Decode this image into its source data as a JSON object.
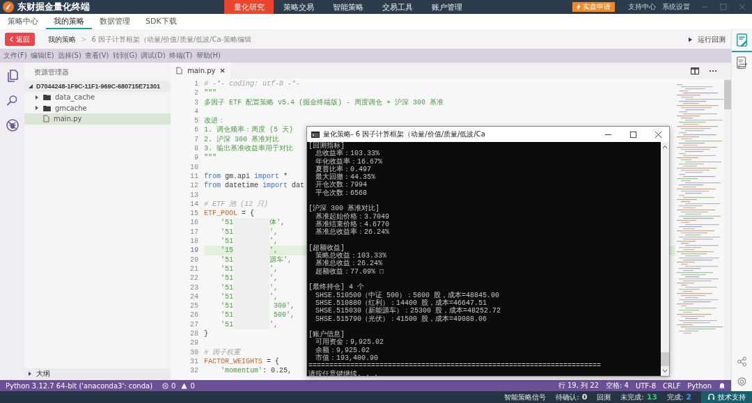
{
  "app": {
    "title": "东财掘金量化终端"
  },
  "nav": [
    {
      "label": "量化研究",
      "selected": true
    },
    {
      "label": "策略交易",
      "selected": false
    },
    {
      "label": "智能策略",
      "selected": false
    },
    {
      "label": "交易工具",
      "selected": false
    },
    {
      "label": "账户管理",
      "selected": false
    }
  ],
  "top_actions": {
    "apply_button": "实盘申请",
    "links": [
      "支持中心",
      "系统设置"
    ]
  },
  "tabs": [
    {
      "label": "策略中心",
      "selected": false
    },
    {
      "label": "我的策略",
      "selected": true
    },
    {
      "label": "数据管理",
      "selected": false
    },
    {
      "label": "SDK下载",
      "selected": false
    }
  ],
  "breadcrumb": {
    "back_button": "返回",
    "items": [
      "我的策略",
      "6 因子计算框架（动量/价值/质量/低波/Ca-策略编辑"
    ],
    "separator": ">",
    "run_button": "运行回测"
  },
  "menu": [
    "文件(F)",
    "编辑(E)",
    "选择(S)",
    "查看(V)",
    "转到(G)",
    "调试(D)",
    "终端(T)",
    "帮助(H)"
  ],
  "explorer": {
    "title": "资源管理器",
    "root": {
      "label": "D7044248-1F9C-11F1-969C-680715E71301",
      "expanded": true,
      "selected": false,
      "children": [
        {
          "kind": "folder",
          "label": "data_cache",
          "expanded": false,
          "selected": false
        },
        {
          "kind": "folder",
          "label": "gmcache",
          "expanded": false,
          "selected": false
        },
        {
          "kind": "file",
          "label": "main.py",
          "selected": true
        }
      ]
    },
    "outline": {
      "label": "大纲",
      "expanded": false
    }
  },
  "editor": {
    "tabs": [
      {
        "label": "main.py",
        "selected": true
      }
    ],
    "lines": [
      {
        "number": "1",
        "selected": false,
        "tokens": [
          {
            "kind": "comment",
            "text": "# -*- coding: utf-8 -*-"
          }
        ]
      },
      {
        "number": "2",
        "selected": false,
        "tokens": [
          {
            "kind": "string",
            "text": "\"\"\""
          }
        ]
      },
      {
        "number": "3",
        "selected": false,
        "tokens": [
          {
            "kind": "string",
            "text": "多因子 ETF 配置策略 v5.4 (掘金终端版) - 周度调仓 + 沪深 300 基准"
          }
        ]
      },
      {
        "number": "4",
        "selected": false
      },
      {
        "number": "5",
        "selected": false,
        "tokens": [
          {
            "kind": "string",
            "text": "改进："
          }
        ]
      },
      {
        "number": "6",
        "selected": false,
        "tokens": [
          {
            "kind": "string",
            "text": "1. 调仓频率：周度 (5 天)"
          }
        ]
      },
      {
        "number": "7",
        "selected": false,
        "tokens": [
          {
            "kind": "string",
            "text": "2. 沪深 300 基准对比"
          }
        ]
      },
      {
        "number": "8",
        "selected": false,
        "tokens": [
          {
            "kind": "string",
            "text": "3. 输出基准收益率用于对比"
          }
        ]
      },
      {
        "number": "9",
        "selected": false,
        "tokens": [
          {
            "kind": "string",
            "text": "\"\"\""
          }
        ]
      },
      {
        "number": "10",
        "selected": false
      },
      {
        "number": "11",
        "selected": false,
        "tokens": [
          {
            "kind": "keyword",
            "text": "from"
          },
          {
            "kind": "plain",
            "text": " gm.api "
          },
          {
            "kind": "keyword",
            "text": "import"
          },
          {
            "kind": "plain",
            "text": " *"
          }
        ]
      },
      {
        "number": "12",
        "selected": false,
        "tokens": [
          {
            "kind": "keyword",
            "text": "from"
          },
          {
            "kind": "plain",
            "text": " datetime "
          },
          {
            "kind": "keyword",
            "text": "import"
          },
          {
            "kind": "plain",
            "text": " dat"
          }
        ]
      },
      {
        "number": "13",
        "selected": false
      },
      {
        "number": "14",
        "selected": false,
        "tokens": [
          {
            "kind": "comment",
            "text": "# ETF 池 (12 只)"
          }
        ]
      },
      {
        "number": "15",
        "selected": false,
        "tokens": [
          {
            "kind": "name",
            "text": "ETF_POOL"
          },
          {
            "kind": "plain",
            "text": " = {"
          }
        ]
      },
      {
        "number": "16",
        "selected": false,
        "tokens": [
          {
            "kind": "string",
            "text": "    '51"
          },
          {
            "kind": "redacted"
          },
          {
            "kind": "string",
            "text": "体',"
          }
        ]
      },
      {
        "number": "17",
        "selected": false,
        "tokens": [
          {
            "kind": "string",
            "text": "    '51"
          },
          {
            "kind": "redacted"
          },
          {
            "kind": "string",
            "text": "',"
          }
        ]
      },
      {
        "number": "18",
        "selected": false,
        "tokens": [
          {
            "kind": "string",
            "text": "    '51"
          },
          {
            "kind": "redacted"
          },
          {
            "kind": "string",
            "text": "',"
          }
        ]
      },
      {
        "number": "19",
        "selected": true,
        "tokens": [
          {
            "kind": "string",
            "text": "    '15"
          },
          {
            "kind": "redacted"
          },
          {
            "kind": "string",
            "text": "',"
          }
        ]
      },
      {
        "number": "20",
        "selected": false,
        "tokens": [
          {
            "kind": "string",
            "text": "    '51"
          },
          {
            "kind": "redacted"
          },
          {
            "kind": "string",
            "text": "源车',"
          }
        ]
      },
      {
        "number": "21",
        "selected": false,
        "tokens": [
          {
            "kind": "string",
            "text": "    '51"
          },
          {
            "kind": "redacted"
          },
          {
            "kind": "string",
            "text": "',"
          }
        ]
      },
      {
        "number": "22",
        "selected": false,
        "tokens": [
          {
            "kind": "string",
            "text": "    '51"
          },
          {
            "kind": "redacted"
          },
          {
            "kind": "string",
            "text": "',"
          }
        ]
      },
      {
        "number": "23",
        "selected": false,
        "tokens": [
          {
            "kind": "string",
            "text": "    '51"
          },
          {
            "kind": "redacted"
          },
          {
            "kind": "string",
            "text": "',"
          }
        ]
      },
      {
        "number": "24",
        "selected": false,
        "tokens": [
          {
            "kind": "string",
            "text": "    '51"
          },
          {
            "kind": "redacted"
          },
          {
            "kind": "string",
            "text": "',"
          }
        ]
      },
      {
        "number": "25",
        "selected": false,
        "tokens": [
          {
            "kind": "string",
            "text": "    '51"
          },
          {
            "kind": "redacted"
          },
          {
            "kind": "string",
            "text": " 300',"
          }
        ]
      },
      {
        "number": "26",
        "selected": false,
        "tokens": [
          {
            "kind": "string",
            "text": "    '51"
          },
          {
            "kind": "redacted"
          },
          {
            "kind": "string",
            "text": " 500',"
          }
        ]
      },
      {
        "number": "27",
        "selected": false,
        "tokens": [
          {
            "kind": "string",
            "text": "    '51"
          },
          {
            "kind": "redacted"
          },
          {
            "kind": "string",
            "text": "',"
          }
        ]
      },
      {
        "number": "28",
        "selected": false,
        "tokens": [
          {
            "kind": "plain",
            "text": "}"
          }
        ]
      },
      {
        "number": "29",
        "selected": false
      },
      {
        "number": "30",
        "selected": false,
        "tokens": [
          {
            "kind": "comment",
            "text": "# 因子权重"
          }
        ]
      },
      {
        "number": "31",
        "selected": false,
        "tokens": [
          {
            "kind": "name",
            "text": "FACTOR_WEIGHTS"
          },
          {
            "kind": "plain",
            "text": " = {"
          }
        ]
      },
      {
        "number": "32",
        "selected": false,
        "tokens": [
          {
            "kind": "string",
            "text": "    'momentum'"
          },
          {
            "kind": "plain",
            "text": ": 0.25,"
          }
        ]
      }
    ]
  },
  "console": {
    "title": "量化策略- 6 因子计算框架（动量/价值/质量/低波/Ca",
    "sections": [
      {
        "heading": "[回测指标]",
        "lines": [
          "总收益率：103.33%",
          "年化收益率：16.67%",
          "夏普比率：0.497",
          "最大回撤：44.35%",
          "开仓次数：7994",
          "平仓次数：6568"
        ]
      },
      {
        "heading": "[沪深 300 基准对比]",
        "lines": [
          "基准起始价格：3.7049",
          "基准结束价格：4.6770",
          "基准总收益率：26.24%"
        ]
      },
      {
        "heading": "[超额收益]",
        "lines": [
          "策略总收益：103.33%",
          "基准总收益：26.24%",
          "超额收益：77.09% □"
        ]
      },
      {
        "heading": "[最终持仓] 4 个",
        "lines": [
          "SHSE.510500（中证 500）：5800 股，成本=48845.00",
          "SHSE.510880（红利）：14400 股，成本=46647.51",
          "SHSE.515030（新能源车）：25300 股，成本=48252.72",
          "SHSE.515790（光伏）：41500 股，成本=49088.06"
        ]
      },
      {
        "heading": "[账户信息]",
        "lines": [
          "可用资金：9,925.02",
          "余额：9,925.02",
          "市值：193,400.90"
        ]
      }
    ],
    "separator": "======================================================================",
    "prompt": "请按任意键继续. . ."
  },
  "status_bar": {
    "interpreter": "Python 3.12.7 64-bit ('anaconda3': conda)",
    "errors": "0",
    "warnings": "0",
    "items": [
      "行 19, 列 22",
      "空格: 4",
      "UTF-8",
      "CRLF",
      "Python"
    ]
  },
  "bottom_bar": {
    "items": [
      {
        "kind": "label",
        "text": "智能策略信号"
      },
      {
        "kind": "counter",
        "label": "待确认:",
        "value": "0",
        "color": "#e6e6e6"
      },
      {
        "kind": "label",
        "text": "回测"
      },
      {
        "kind": "counter",
        "label": "未完成:",
        "value": "13",
        "color": "#35c27a"
      },
      {
        "kind": "counter",
        "label": "完成:",
        "value": "2",
        "color": "#3a9be8"
      }
    ],
    "support_button": "技术支持"
  }
}
